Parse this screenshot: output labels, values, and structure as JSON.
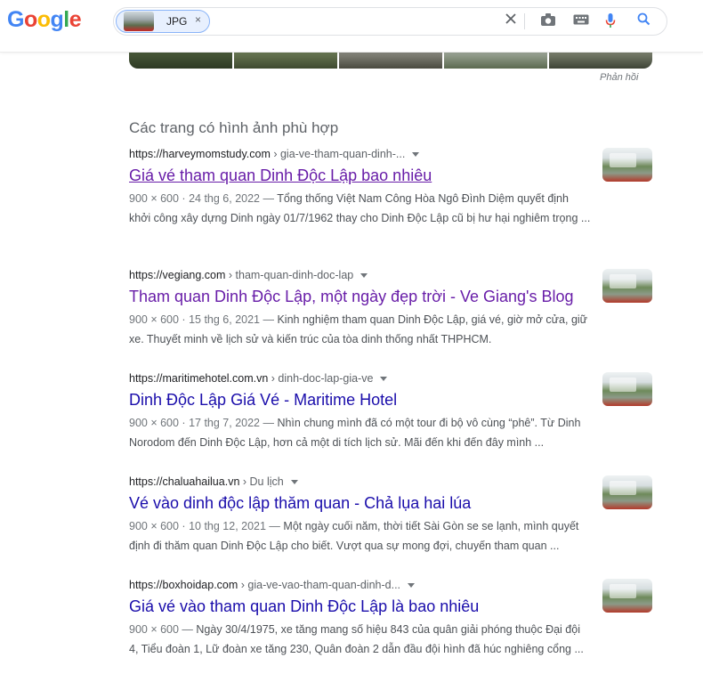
{
  "header": {
    "logo_letters": [
      "G",
      "o",
      "o",
      "g",
      "l",
      "e"
    ],
    "chip_label": "JPG",
    "chip_remove": "×",
    "icons": {
      "clear": "clear-icon",
      "camera": "camera-icon",
      "keyboard": "keyboard-icon",
      "mic": "mic-icon",
      "search": "search-icon"
    }
  },
  "feedback_label": "Phản hồi",
  "section_title": "Các trang có hình ảnh phù hợp",
  "results": [
    {
      "domain": "https://harveymomstudy.com",
      "crumb": " › gia-ve-tham-quan-dinh-...",
      "title": "Giá vé tham quan Dinh Độc Lập bao nhiêu",
      "meta": "900 × 600 · 24 thg 6, 2022 — ",
      "snippet": "Tổng thống Việt Nam Công Hòa Ngô Đình Diệm quyết định khởi công xây dựng Dinh ngày 01/7/1962 thay cho Dinh Độc Lập cũ bị hư hại nghiêm trọng ..."
    },
    {
      "domain": "https://vegiang.com",
      "crumb": " › tham-quan-dinh-doc-lap",
      "title": "Tham quan Dinh Độc Lập, một ngày đẹp trời - Ve Giang's Blog",
      "meta": "900 × 600 · 15 thg 6, 2021 — ",
      "snippet": "Kinh nghiệm tham quan Dinh Độc Lập, giá vé, giờ mở cửa, giữ xe. Thuyết minh về lịch sử và kiến trúc của tòa dinh thống nhất THPHCM."
    },
    {
      "domain": "https://maritimehotel.com.vn",
      "crumb": " › dinh-doc-lap-gia-ve",
      "title": "Dinh Độc Lập Giá Vé - Maritime Hotel",
      "meta": "900 × 600 · 17 thg 7, 2022 — ",
      "snippet": "Nhìn chung mình đã có một tour đi bộ vô cùng “phê”. Từ Dinh Norodom đến Dinh Độc Lập, hơn cả một di tích lịch sử. Mãi đến khi đến đây mình ..."
    },
    {
      "domain": "https://chaluahailua.vn",
      "crumb": " › Du lịch",
      "title": "Vé vào dinh độc lập thăm quan - Chả lụa hai lúa",
      "meta": "900 × 600 · 10 thg 12, 2021 — ",
      "snippet": "Một ngày cuối năm, thời tiết Sài Gòn se se lạnh, mình quyết định đi thăm quan Dinh Độc Lập cho biết. Vượt qua sự mong đợi, chuyến tham quan ..."
    },
    {
      "domain": "https://boxhoidap.com",
      "crumb": " › gia-ve-vao-tham-quan-dinh-d...",
      "title": "Giá vé vào tham quan Dinh Độc Lập là bao nhiêu",
      "meta": "900 × 600 — ",
      "snippet": "Ngày 30/4/1975, xe tăng mang số hiệu 843 của quân giải phóng thuộc Đại đội 4, Tiểu đoàn 1, Lữ đoàn xe tăng 230, Quân đoàn 2 dẫn đầu đội hình đã húc nghiêng cổng ..."
    }
  ]
}
